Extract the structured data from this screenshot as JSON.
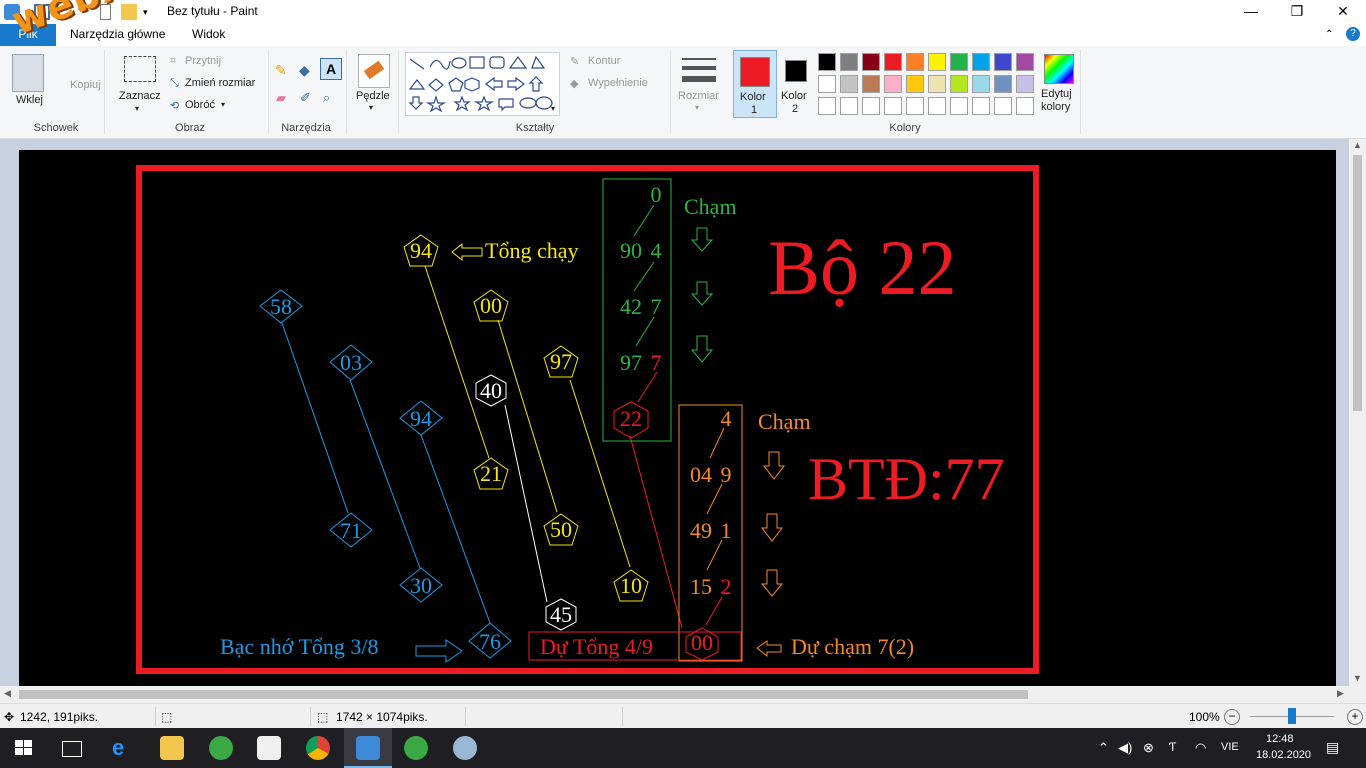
{
  "window": {
    "title": "Bez tytułu - Paint",
    "minimize": "—",
    "maximize": "❐",
    "close": "✕"
  },
  "tabs": {
    "file": "Plik",
    "home": "Narzędzia główne",
    "view": "Widok"
  },
  "ribbon": {
    "clipboard": {
      "paste": "Wklej",
      "copy": "Kopiuj",
      "group": "Schowek"
    },
    "image": {
      "select": "Zaznacz",
      "crop": "Przytnij",
      "resize": "Zmień rozmiar",
      "rotate": "Obróć",
      "group": "Obraz"
    },
    "tools": {
      "group": "Narzędzia"
    },
    "brushes": {
      "label": "Pędzle"
    },
    "shapes": {
      "outline": "Kontur",
      "fill": "Wypełnienie",
      "group": "Kształty"
    },
    "size": {
      "label": "Rozmiar"
    },
    "color1": {
      "label": "Kolor",
      "num": "1",
      "color": "#ed1c24"
    },
    "color2": {
      "label": "Kolor",
      "num": "2",
      "color": "#000000"
    },
    "edit_colors": {
      "line1": "Edytuj",
      "line2": "kolory"
    },
    "colors_group": "Kolory",
    "palette_row1": [
      "#000000",
      "#7f7f7f",
      "#880015",
      "#ed1c24",
      "#ff7f27",
      "#fff200",
      "#22b14c",
      "#00a2e8",
      "#3f48cc",
      "#a349a4"
    ],
    "palette_row2": [
      "#ffffff",
      "#c3c3c3",
      "#b97a57",
      "#ffaec9",
      "#ffc90e",
      "#efe4b0",
      "#b5e61d",
      "#99d9ea",
      "#7092be",
      "#c8bfe7"
    ]
  },
  "drawing": {
    "colors": {
      "blue": "#1b9be6",
      "yellow": "#f5e611",
      "white": "#ffffff",
      "green": "#2db342",
      "orange": "#f58a24",
      "red": "#ed1c24"
    },
    "blue_labels": [
      "58",
      "03",
      "94",
      "71",
      "30",
      "76"
    ],
    "yellow_labels": [
      "94",
      "00",
      "97",
      "21",
      "50",
      "10"
    ],
    "white_labels": [
      "40",
      "45"
    ],
    "green_col": [
      "0",
      "90",
      "4",
      "42",
      "7",
      "97"
    ],
    "red_seven": "7",
    "red_22": "22",
    "cham_green": "Chạm",
    "tong_chay": "Tổng chạy",
    "bo": "Bộ 22",
    "orange_col": [
      "4",
      "04",
      "9",
      "49",
      "1",
      "15"
    ],
    "red_two": "2",
    "cham_orange": "Chạm",
    "btd": "BTĐ:77",
    "bac_nho": "Bạc nhớ Tổng 3/8",
    "du_tong": "Dự Tổng 4/9",
    "du_00": "00",
    "du_cham": "Dự chạm 7(2)"
  },
  "status": {
    "cursor_pos": "1242, 191piks.",
    "image_size": "1742 × 1074piks.",
    "zoom": "100%",
    "zoom_fraction": 0.5
  },
  "taskbar": {
    "lang": "VIE",
    "time": "12:48",
    "date": "18.02.2020"
  },
  "watermark": "webxoso.net"
}
